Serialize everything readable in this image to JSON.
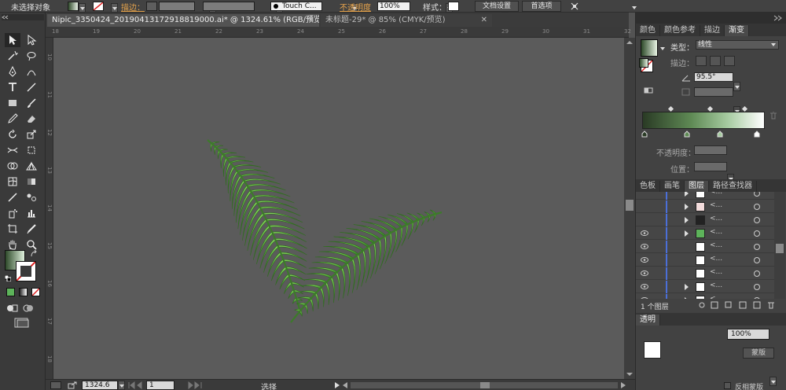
{
  "control_bar": {
    "selection_status": "未选择对象",
    "stroke_label": "描边：",
    "brush_name": "Touch C...",
    "opacity_label": "不透明度",
    "opacity_value": "100%",
    "style_label": "样式：",
    "doc_setup_button": "文档设置",
    "preferences_button": "首选项"
  },
  "tabs": [
    {
      "label": "Nipic_3350424_20190413172918819000.ai* @ 1324.61% (RGB/预览)",
      "active": true
    },
    {
      "label": "未标题-29* @ 85% (CMYK/预览)",
      "active": false
    }
  ],
  "ruler": {
    "top_labels": [
      "18",
      "19",
      "20",
      "21",
      "22",
      "23",
      "24",
      "25",
      "26",
      "27",
      "28",
      "29",
      "30",
      "31",
      "32"
    ],
    "left_labels": [
      "10",
      "11",
      "12",
      "13",
      "14",
      "15",
      "16",
      "17",
      "18"
    ]
  },
  "status_bar": {
    "zoom": "1324.6",
    "page": "1",
    "tool_status": "选择"
  },
  "gradient_panel": {
    "tabs": [
      "颜色",
      "颜色参考",
      "描边",
      "渐变"
    ],
    "type_label": "类型：",
    "type_value": "线性",
    "stroke_label": "描边：",
    "angle_value": "95.5°",
    "opacity_label": "不透明度：",
    "position_label": "位置："
  },
  "layers_panel": {
    "tabs": [
      "色板",
      "画笔",
      "图层",
      "路径查找器"
    ],
    "layer_count": "1 个图层",
    "row_name": "<..."
  },
  "transparency_panel": {
    "tab": "透明",
    "percent": "100%",
    "mask_button": "蒙版",
    "invert_mask_label": "反相蒙版"
  },
  "colors": {
    "accent_blue": "#4b6fd8",
    "leaf_dark": "#2f6d1e",
    "leaf_light": "#7fd15a",
    "gradient_start": "#2a3b25",
    "gradient_end": "#ffffff"
  }
}
